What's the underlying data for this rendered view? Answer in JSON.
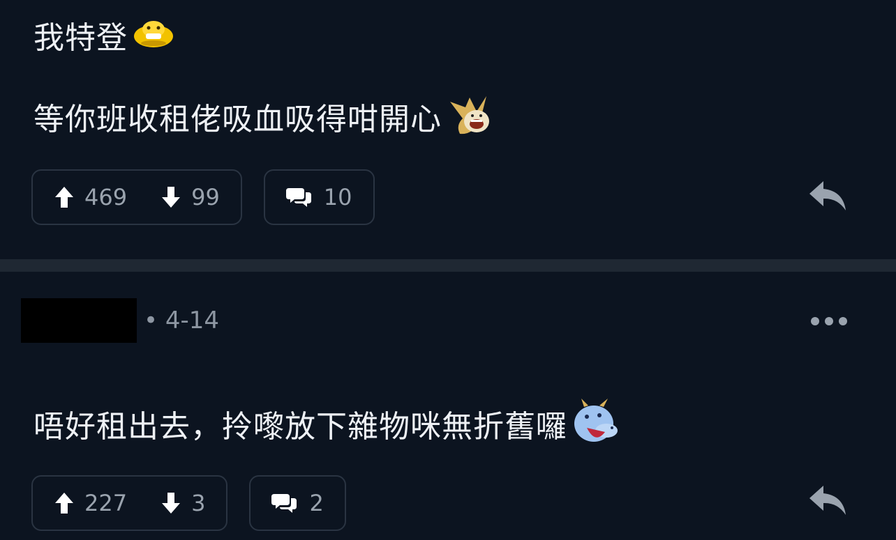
{
  "comments": [
    {
      "lines": [
        "我特登",
        "等你班收租佬吸血吸得咁開心"
      ],
      "upvotes": "469",
      "downvotes": "99",
      "replies": "10"
    },
    {
      "date": "• 4-14",
      "lines": [
        "唔好租出去，拎嚟放下雜物咪無折舊囉"
      ],
      "upvotes": "227",
      "downvotes": "3",
      "replies": "2"
    }
  ],
  "icons": {
    "upvote": "arrow-up-icon",
    "downvote": "arrow-down-icon",
    "replies": "chat-bubble-icon",
    "reply": "reply-arrow-icon",
    "more": "more-options-icon",
    "emoji_1": "yellow-face-emoji",
    "emoji_2": "banana-face-emoji",
    "emoji_3": "blue-dragon-emoji"
  },
  "colors": {
    "background": "#0c1420",
    "separator": "#1f2833",
    "text": "#eef1f5",
    "muted": "#9aa3ae"
  }
}
